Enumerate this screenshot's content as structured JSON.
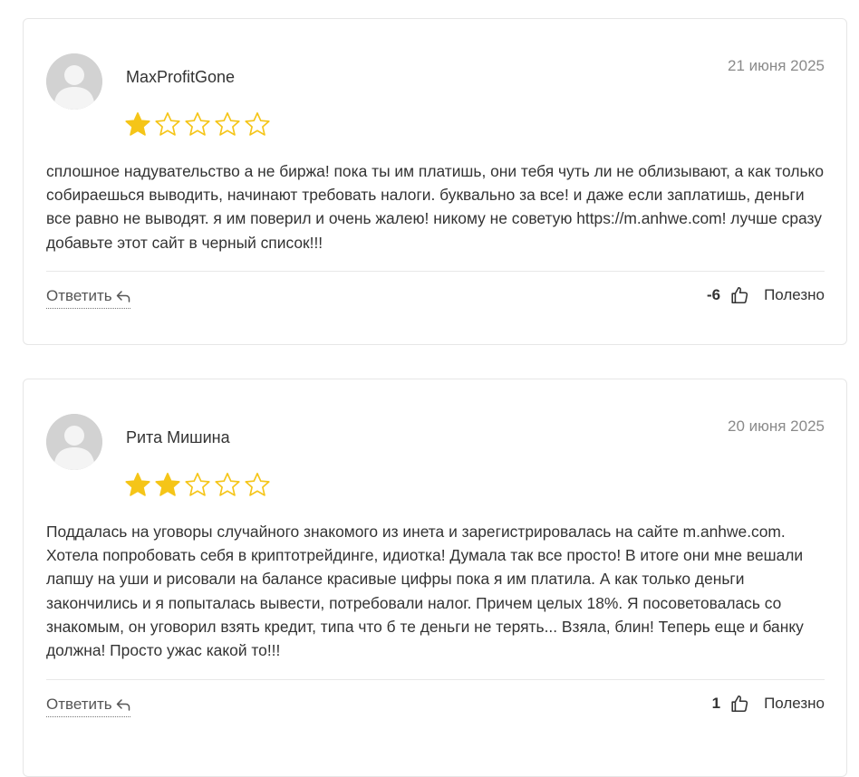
{
  "reviews": [
    {
      "author": "MaxProfitGone",
      "date": "21 июня 2025",
      "rating": 1,
      "rating_max": 5,
      "text": "сплошное надувательство а не биржа! пока ты им платишь, они тебя чуть ли не облизывают, а как только собираешься выводить, начинают требовать налоги. буквально за все! и даже если заплатишь, деньги все равно не выводят. я им поверил и очень жалею! никому не советую https://m.anhwe.com! лучше сразу добавьте этот сайт в черный список!!!",
      "reply_label": "Ответить",
      "votes": "-6",
      "helpful_label": "Полезно"
    },
    {
      "author": "Рита Мишина",
      "date": "20 июня 2025",
      "rating": 2,
      "rating_max": 5,
      "text": "Поддалась на уговоры случайного знакомого из инета и зарегистрировалась на сайте m.anhwe.com. Хотела попробовать себя в криптотрейдинге, идиотка! Думала так все просто! В итоге они мне вешали лапшу на уши и рисовали на балансе красивые цифры пока я им платила. А как только деньги закончились и я попыталась вывести, потребовали налог. Причем целых 18%. Я посоветовалась со знакомым, он уговорил взять кредит, типа что б те деньги не терять... Взяла, блин! Теперь еще и банку должна! Просто ужас какой то!!!",
      "reply_label": "Ответить",
      "votes": "1",
      "helpful_label": "Полезно"
    }
  ],
  "colors": {
    "star_filled": "#f5c518",
    "star_outline": "#f5c518",
    "avatar_bg": "#d2d2d2",
    "date": "#8a8a8a",
    "text": "#333333",
    "border": "#e6e6e6"
  },
  "icons": {
    "star": "star-icon",
    "reply": "reply-arrow-icon",
    "helpful": "thumbs-up-icon",
    "avatar": "user-placeholder-icon"
  }
}
